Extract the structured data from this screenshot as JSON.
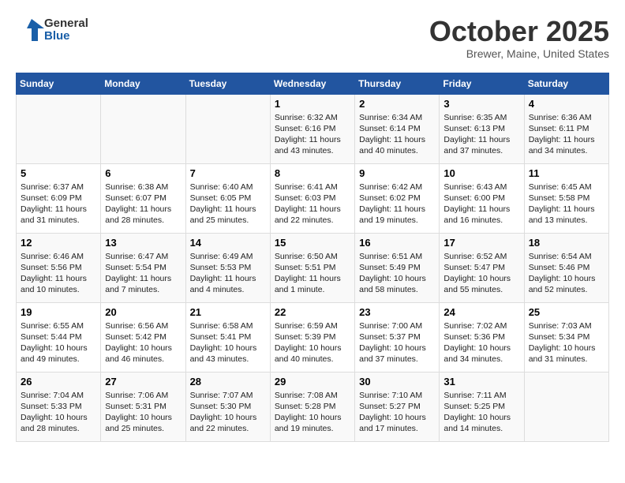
{
  "header": {
    "logo_line1": "General",
    "logo_line2": "Blue",
    "month": "October 2025",
    "location": "Brewer, Maine, United States"
  },
  "weekdays": [
    "Sunday",
    "Monday",
    "Tuesday",
    "Wednesday",
    "Thursday",
    "Friday",
    "Saturday"
  ],
  "weeks": [
    [
      {
        "day": "",
        "info": ""
      },
      {
        "day": "",
        "info": ""
      },
      {
        "day": "",
        "info": ""
      },
      {
        "day": "1",
        "info": "Sunrise: 6:32 AM\nSunset: 6:16 PM\nDaylight: 11 hours and 43 minutes."
      },
      {
        "day": "2",
        "info": "Sunrise: 6:34 AM\nSunset: 6:14 PM\nDaylight: 11 hours and 40 minutes."
      },
      {
        "day": "3",
        "info": "Sunrise: 6:35 AM\nSunset: 6:13 PM\nDaylight: 11 hours and 37 minutes."
      },
      {
        "day": "4",
        "info": "Sunrise: 6:36 AM\nSunset: 6:11 PM\nDaylight: 11 hours and 34 minutes."
      }
    ],
    [
      {
        "day": "5",
        "info": "Sunrise: 6:37 AM\nSunset: 6:09 PM\nDaylight: 11 hours and 31 minutes."
      },
      {
        "day": "6",
        "info": "Sunrise: 6:38 AM\nSunset: 6:07 PM\nDaylight: 11 hours and 28 minutes."
      },
      {
        "day": "7",
        "info": "Sunrise: 6:40 AM\nSunset: 6:05 PM\nDaylight: 11 hours and 25 minutes."
      },
      {
        "day": "8",
        "info": "Sunrise: 6:41 AM\nSunset: 6:03 PM\nDaylight: 11 hours and 22 minutes."
      },
      {
        "day": "9",
        "info": "Sunrise: 6:42 AM\nSunset: 6:02 PM\nDaylight: 11 hours and 19 minutes."
      },
      {
        "day": "10",
        "info": "Sunrise: 6:43 AM\nSunset: 6:00 PM\nDaylight: 11 hours and 16 minutes."
      },
      {
        "day": "11",
        "info": "Sunrise: 6:45 AM\nSunset: 5:58 PM\nDaylight: 11 hours and 13 minutes."
      }
    ],
    [
      {
        "day": "12",
        "info": "Sunrise: 6:46 AM\nSunset: 5:56 PM\nDaylight: 11 hours and 10 minutes."
      },
      {
        "day": "13",
        "info": "Sunrise: 6:47 AM\nSunset: 5:54 PM\nDaylight: 11 hours and 7 minutes."
      },
      {
        "day": "14",
        "info": "Sunrise: 6:49 AM\nSunset: 5:53 PM\nDaylight: 11 hours and 4 minutes."
      },
      {
        "day": "15",
        "info": "Sunrise: 6:50 AM\nSunset: 5:51 PM\nDaylight: 11 hours and 1 minute."
      },
      {
        "day": "16",
        "info": "Sunrise: 6:51 AM\nSunset: 5:49 PM\nDaylight: 10 hours and 58 minutes."
      },
      {
        "day": "17",
        "info": "Sunrise: 6:52 AM\nSunset: 5:47 PM\nDaylight: 10 hours and 55 minutes."
      },
      {
        "day": "18",
        "info": "Sunrise: 6:54 AM\nSunset: 5:46 PM\nDaylight: 10 hours and 52 minutes."
      }
    ],
    [
      {
        "day": "19",
        "info": "Sunrise: 6:55 AM\nSunset: 5:44 PM\nDaylight: 10 hours and 49 minutes."
      },
      {
        "day": "20",
        "info": "Sunrise: 6:56 AM\nSunset: 5:42 PM\nDaylight: 10 hours and 46 minutes."
      },
      {
        "day": "21",
        "info": "Sunrise: 6:58 AM\nSunset: 5:41 PM\nDaylight: 10 hours and 43 minutes."
      },
      {
        "day": "22",
        "info": "Sunrise: 6:59 AM\nSunset: 5:39 PM\nDaylight: 10 hours and 40 minutes."
      },
      {
        "day": "23",
        "info": "Sunrise: 7:00 AM\nSunset: 5:37 PM\nDaylight: 10 hours and 37 minutes."
      },
      {
        "day": "24",
        "info": "Sunrise: 7:02 AM\nSunset: 5:36 PM\nDaylight: 10 hours and 34 minutes."
      },
      {
        "day": "25",
        "info": "Sunrise: 7:03 AM\nSunset: 5:34 PM\nDaylight: 10 hours and 31 minutes."
      }
    ],
    [
      {
        "day": "26",
        "info": "Sunrise: 7:04 AM\nSunset: 5:33 PM\nDaylight: 10 hours and 28 minutes."
      },
      {
        "day": "27",
        "info": "Sunrise: 7:06 AM\nSunset: 5:31 PM\nDaylight: 10 hours and 25 minutes."
      },
      {
        "day": "28",
        "info": "Sunrise: 7:07 AM\nSunset: 5:30 PM\nDaylight: 10 hours and 22 minutes."
      },
      {
        "day": "29",
        "info": "Sunrise: 7:08 AM\nSunset: 5:28 PM\nDaylight: 10 hours and 19 minutes."
      },
      {
        "day": "30",
        "info": "Sunrise: 7:10 AM\nSunset: 5:27 PM\nDaylight: 10 hours and 17 minutes."
      },
      {
        "day": "31",
        "info": "Sunrise: 7:11 AM\nSunset: 5:25 PM\nDaylight: 10 hours and 14 minutes."
      },
      {
        "day": "",
        "info": ""
      }
    ]
  ]
}
